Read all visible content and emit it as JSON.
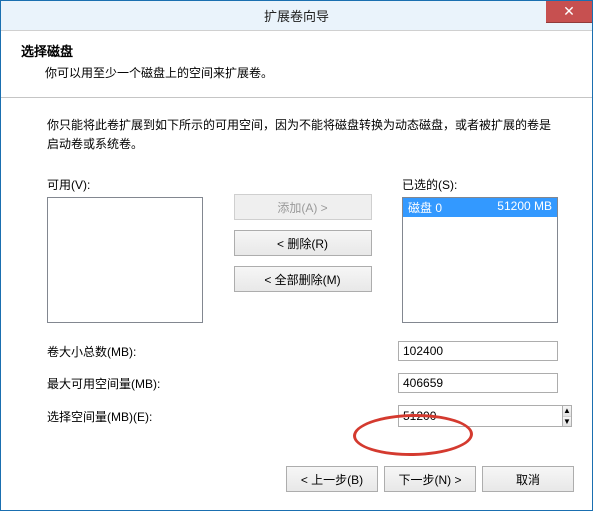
{
  "window": {
    "title": "扩展卷向导",
    "close_symbol": "✕"
  },
  "header": {
    "title": "选择磁盘",
    "subtitle": "你可以用至少一个磁盘上的空间来扩展卷。"
  },
  "note": "你只能将此卷扩展到如下所示的可用空间，因为不能将磁盘转换为动态磁盘，或者被扩展的卷是启动卷或系统卷。",
  "lists": {
    "available_label": "可用(V):",
    "selected_label": "已选的(S):",
    "selected_items": [
      {
        "name": "磁盘 0",
        "size": "51200 MB"
      }
    ]
  },
  "buttons": {
    "add": "添加(A) >",
    "remove": "< 删除(R)",
    "remove_all": "< 全部删除(M)",
    "back": "< 上一步(B)",
    "next": "下一步(N) >",
    "cancel": "取消"
  },
  "fields": {
    "total_size_label": "卷大小总数(MB):",
    "total_size_value": "102400",
    "max_space_label": "最大可用空间量(MB):",
    "max_space_value": "406659",
    "select_space_label": "选择空间量(MB)(E):",
    "select_space_value": "51200"
  }
}
